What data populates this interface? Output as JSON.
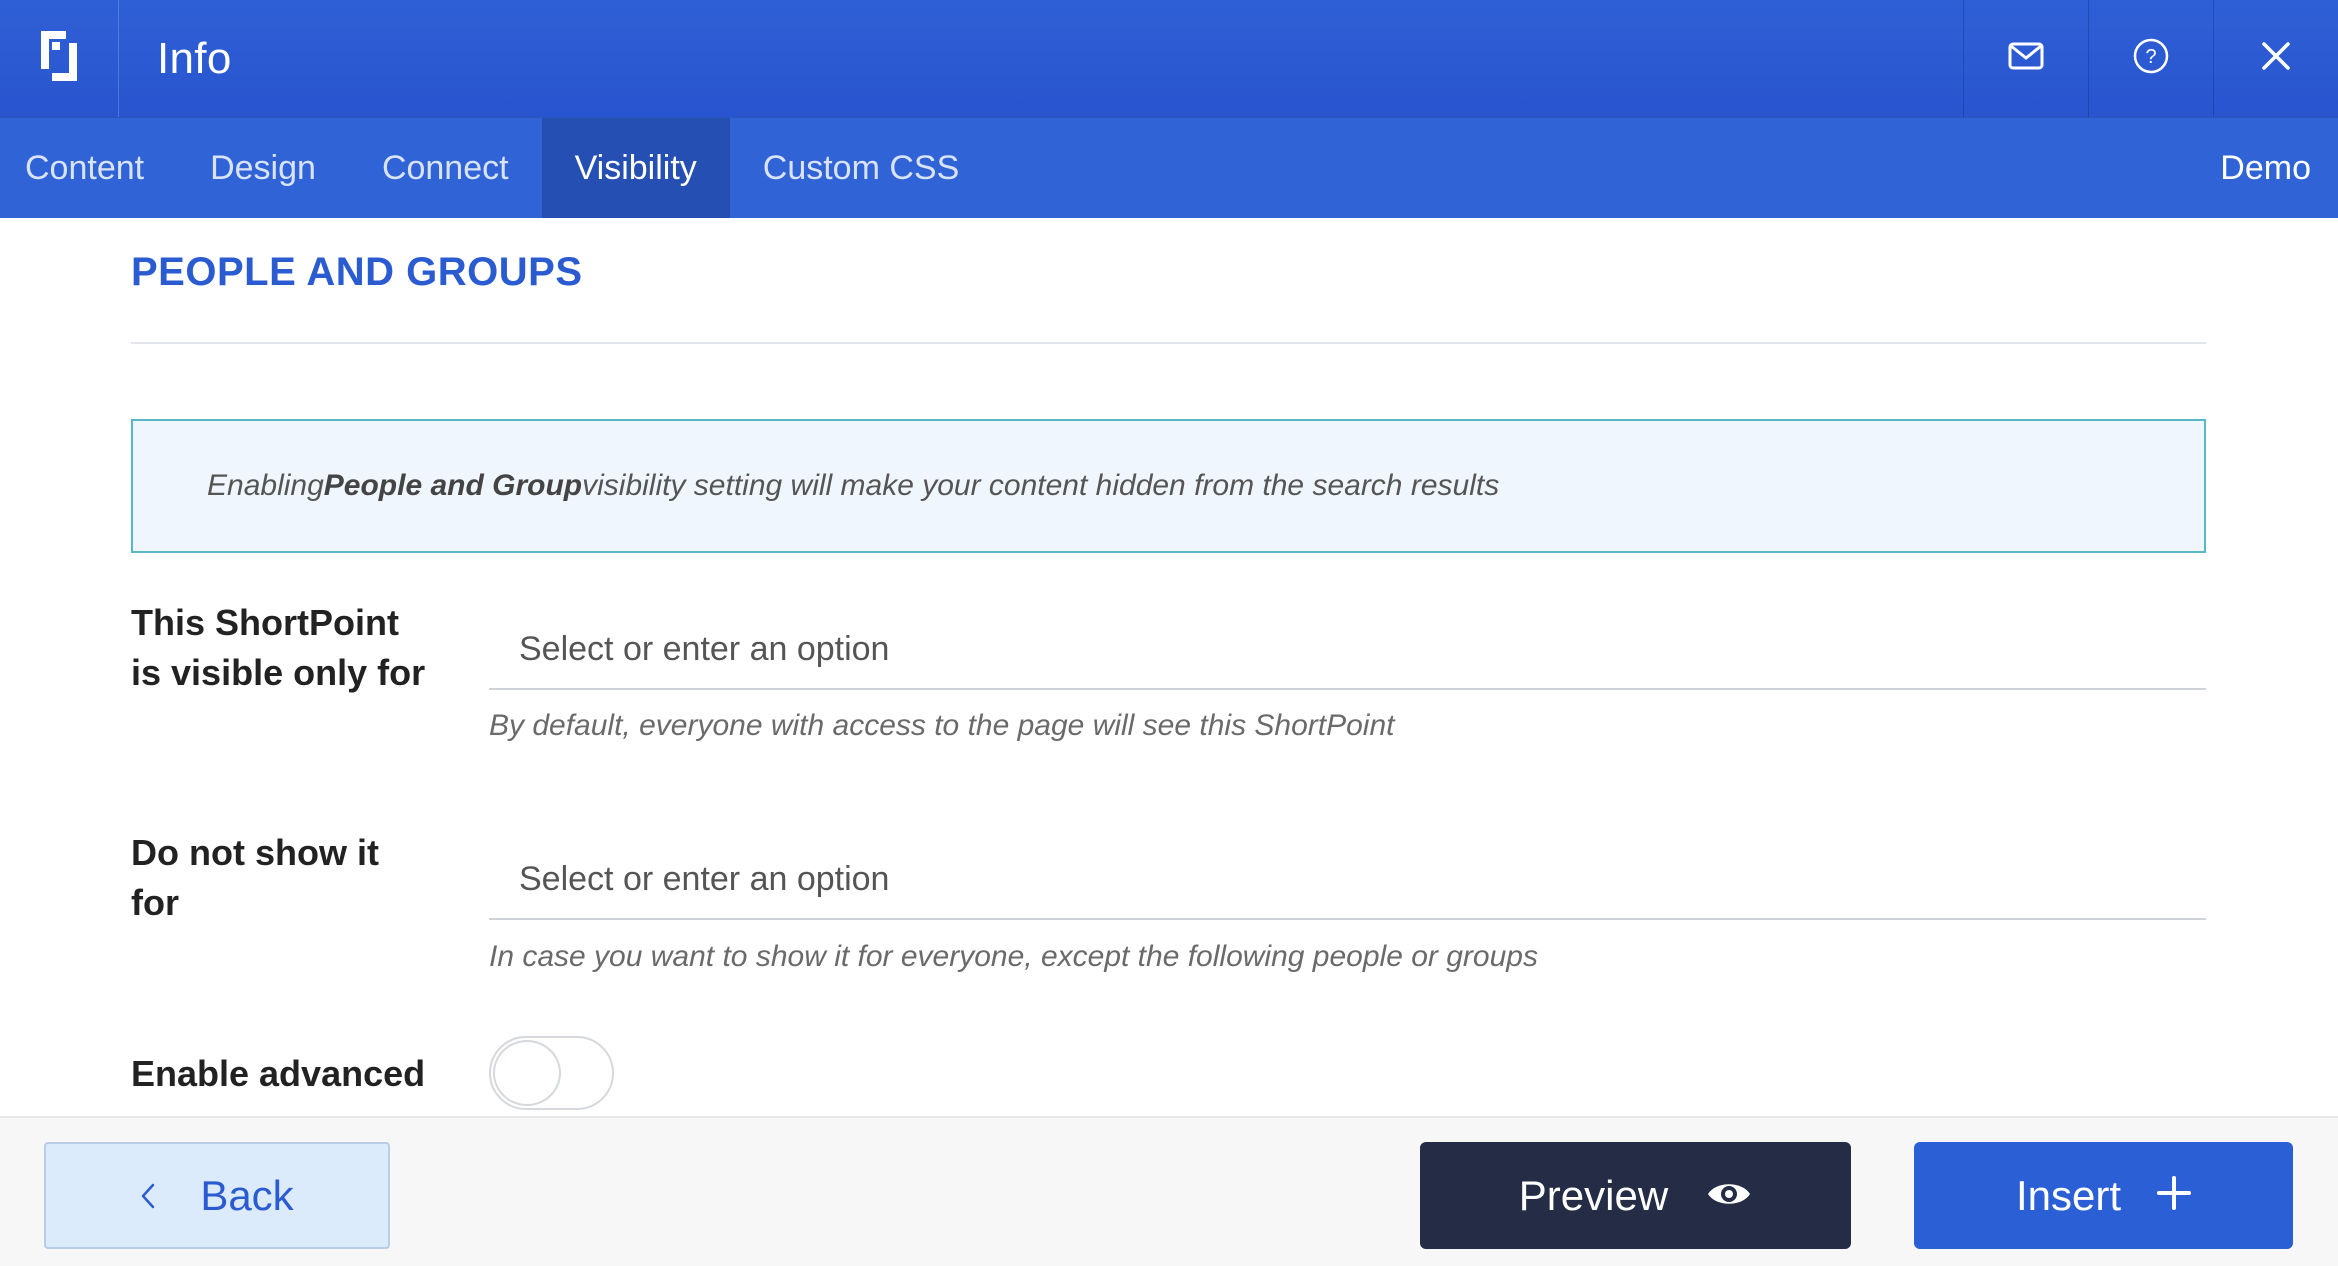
{
  "header": {
    "title": "Info",
    "icons": [
      "shortpoint-logo-icon",
      "mail-icon",
      "help-icon",
      "close-icon"
    ]
  },
  "tabs": {
    "items": [
      {
        "label": "Content"
      },
      {
        "label": "Design"
      },
      {
        "label": "Connect"
      },
      {
        "label": "Visibility",
        "active": true
      },
      {
        "label": "Custom CSS"
      }
    ],
    "demo_label": "Demo"
  },
  "section": {
    "title": "PEOPLE AND GROUPS"
  },
  "notice": {
    "prefix": "Enabling ",
    "bold": "People and Group",
    "suffix": " visibility setting will make your content hidden from the search results"
  },
  "fields": {
    "visible_only_for": {
      "label": "This ShortPoint is visible only for",
      "placeholder": "Select or enter an option",
      "help": "By default, everyone with access to the page will see this ShortPoint"
    },
    "do_not_show_for": {
      "label": "Do not show it for",
      "placeholder": "Select or enter an option",
      "help": "In case you want to show it for everyone, except the following people or groups"
    },
    "enable_advanced": {
      "label": "Enable advanced",
      "enabled": false
    }
  },
  "footer": {
    "back_label": "Back",
    "preview_label": "Preview",
    "insert_label": "Insert"
  },
  "colors": {
    "header_bg": "#2f5fd6",
    "tab_active_bg": "#264fb3",
    "accent": "#2a5bd0",
    "notice_border": "#58b7c8",
    "preview_bg": "#252c46"
  }
}
